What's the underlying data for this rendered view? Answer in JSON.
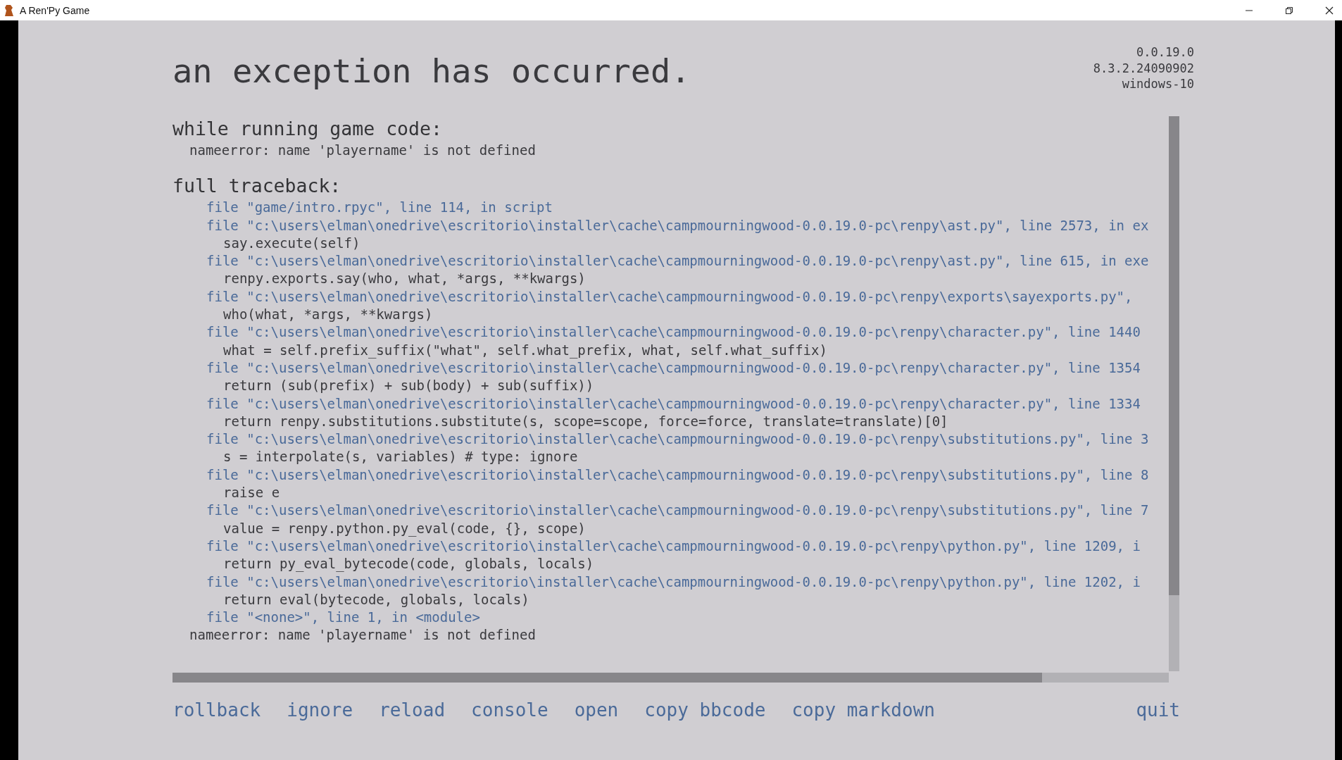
{
  "window": {
    "title": "A Ren'Py Game"
  },
  "title": "an exception has occurred.",
  "version_info": [
    "0.0.19.0",
    "8.3.2.24090902",
    "windows-10"
  ],
  "sections": [
    {
      "heading": "while running game code:",
      "lines": [
        {
          "kind": "error",
          "text": "nameerror: name 'playername' is not defined"
        }
      ]
    },
    {
      "heading": "full traceback:",
      "lines": [
        {
          "kind": "file",
          "text": "file \"game/intro.rpyc\", line 114, in script"
        },
        {
          "kind": "file",
          "text": "file \"c:\\users\\elman\\onedrive\\escritorio\\installer\\cache\\campmourningwood-0.0.19.0-pc\\renpy\\ast.py\", line 2573, in ex"
        },
        {
          "kind": "code",
          "text": "say.execute(self)"
        },
        {
          "kind": "file",
          "text": "file \"c:\\users\\elman\\onedrive\\escritorio\\installer\\cache\\campmourningwood-0.0.19.0-pc\\renpy\\ast.py\", line 615, in exe"
        },
        {
          "kind": "code",
          "text": "renpy.exports.say(who, what, *args, **kwargs)"
        },
        {
          "kind": "file",
          "text": "file \"c:\\users\\elman\\onedrive\\escritorio\\installer\\cache\\campmourningwood-0.0.19.0-pc\\renpy\\exports\\sayexports.py\","
        },
        {
          "kind": "code",
          "text": "who(what, *args, **kwargs)"
        },
        {
          "kind": "file",
          "text": "file \"c:\\users\\elman\\onedrive\\escritorio\\installer\\cache\\campmourningwood-0.0.19.0-pc\\renpy\\character.py\", line 1440"
        },
        {
          "kind": "code",
          "text": "what = self.prefix_suffix(\"what\", self.what_prefix, what, self.what_suffix)"
        },
        {
          "kind": "file",
          "text": "file \"c:\\users\\elman\\onedrive\\escritorio\\installer\\cache\\campmourningwood-0.0.19.0-pc\\renpy\\character.py\", line 1354"
        },
        {
          "kind": "code",
          "text": "return (sub(prefix) + sub(body) + sub(suffix))"
        },
        {
          "kind": "file",
          "text": "file \"c:\\users\\elman\\onedrive\\escritorio\\installer\\cache\\campmourningwood-0.0.19.0-pc\\renpy\\character.py\", line 1334"
        },
        {
          "kind": "code",
          "text": "return renpy.substitutions.substitute(s, scope=scope, force=force, translate=translate)[0]"
        },
        {
          "kind": "file",
          "text": "file \"c:\\users\\elman\\onedrive\\escritorio\\installer\\cache\\campmourningwood-0.0.19.0-pc\\renpy\\substitutions.py\", line 3"
        },
        {
          "kind": "code",
          "text": "s = interpolate(s, variables) # type: ignore"
        },
        {
          "kind": "file",
          "text": "file \"c:\\users\\elman\\onedrive\\escritorio\\installer\\cache\\campmourningwood-0.0.19.0-pc\\renpy\\substitutions.py\", line 8"
        },
        {
          "kind": "code",
          "text": "raise e"
        },
        {
          "kind": "file",
          "text": "file \"c:\\users\\elman\\onedrive\\escritorio\\installer\\cache\\campmourningwood-0.0.19.0-pc\\renpy\\substitutions.py\", line 7"
        },
        {
          "kind": "code",
          "text": "value = renpy.python.py_eval(code, {}, scope)"
        },
        {
          "kind": "file",
          "text": "file \"c:\\users\\elman\\onedrive\\escritorio\\installer\\cache\\campmourningwood-0.0.19.0-pc\\renpy\\python.py\", line 1209, i"
        },
        {
          "kind": "code",
          "text": "return py_eval_bytecode(code, globals, locals)"
        },
        {
          "kind": "file",
          "text": "file \"c:\\users\\elman\\onedrive\\escritorio\\installer\\cache\\campmourningwood-0.0.19.0-pc\\renpy\\python.py\", line 1202, i"
        },
        {
          "kind": "code",
          "text": "return eval(bytecode, globals, locals)"
        },
        {
          "kind": "file",
          "text": "file \"<none>\", line 1, in <module>"
        },
        {
          "kind": "error",
          "text": "nameerror: name 'playername' is not defined"
        }
      ]
    }
  ],
  "actions": [
    "rollback",
    "ignore",
    "reload",
    "console",
    "open",
    "copy bbcode",
    "copy markdown"
  ],
  "quit": "quit"
}
